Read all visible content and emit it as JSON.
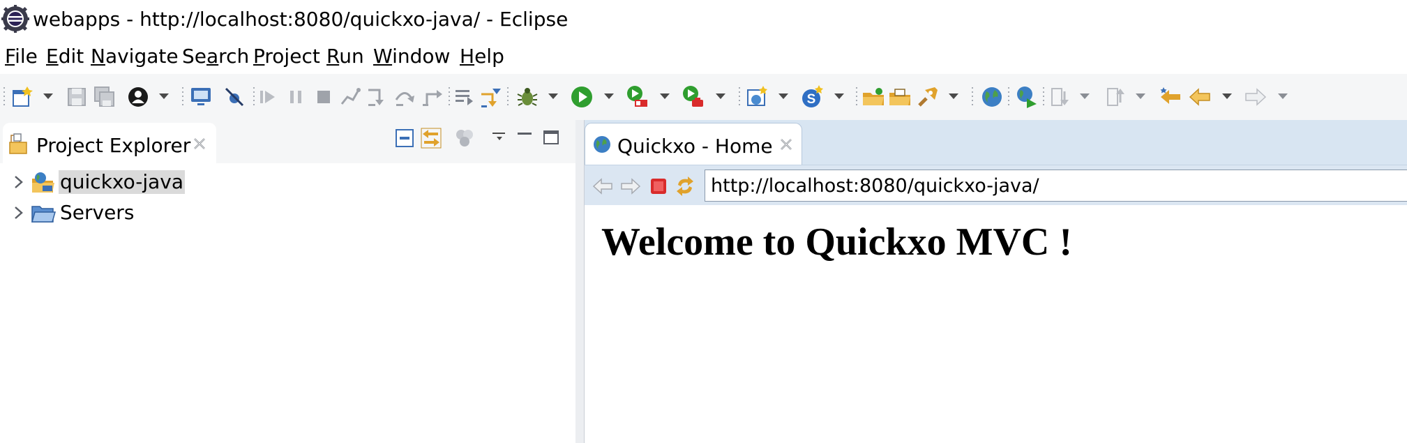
{
  "window": {
    "title": "webapps - http://localhost:8080/quickxo-java/ - Eclipse",
    "app_icon": "eclipse-icon"
  },
  "menu": {
    "items": [
      {
        "mnemonic": "F",
        "rest": "ile"
      },
      {
        "mnemonic": "E",
        "rest": "dit"
      },
      {
        "mnemonic": "N",
        "rest": "avigate"
      },
      {
        "pre": "Se",
        "mnemonic": "a",
        "rest": "rch"
      },
      {
        "mnemonic": "P",
        "rest": "roject"
      },
      {
        "mnemonic": "R",
        "rest": "un"
      },
      {
        "mnemonic": "W",
        "rest": "indow"
      },
      {
        "mnemonic": "H",
        "rest": "elp"
      }
    ]
  },
  "toolbar": {
    "icons": [
      "new-wizard-icon",
      "save-icon",
      "save-all-icon",
      "perspective-icon",
      "console-icon",
      "skip-breakpoints-icon",
      "resume-icon",
      "suspend-icon",
      "terminate-icon",
      "disconnect-icon",
      "step-into-icon",
      "step-over-icon",
      "step-return-icon",
      "drop-to-frame-icon",
      "use-step-filters-icon",
      "debug-icon",
      "run-icon",
      "coverage-icon",
      "external-tools-icon",
      "new-java-project-icon",
      "new-server-icon",
      "open-type-icon",
      "open-task-icon",
      "search-icon",
      "globe-icon",
      "web-browser-icon",
      "next-annotation-icon",
      "previous-annotation-icon",
      "last-edit-location-icon",
      "back-icon",
      "forward-icon"
    ]
  },
  "left_view": {
    "tab_label": "Project Explorer",
    "tab_icon": "project-explorer-icon",
    "tree": [
      {
        "label": "quickxo-java",
        "icon": "web-project-icon",
        "selected": true
      },
      {
        "label": "Servers",
        "icon": "folder-icon",
        "selected": false
      }
    ]
  },
  "editor": {
    "tab_label": "Quickxo - Home",
    "tab_icon": "globe-icon",
    "url": "http://localhost:8080/quickxo-java/",
    "heading": "Welcome to Quickxo MVC !"
  },
  "colors": {
    "toolbar_bg": "#f5f6f7",
    "editor_tab_bar": "#d8e5f2",
    "selection": "#dadada",
    "stop_red": "#d92b2b",
    "run_green": "#2f9e2f",
    "icon_blue": "#3b6fb6",
    "icon_gold": "#e0a22c"
  }
}
